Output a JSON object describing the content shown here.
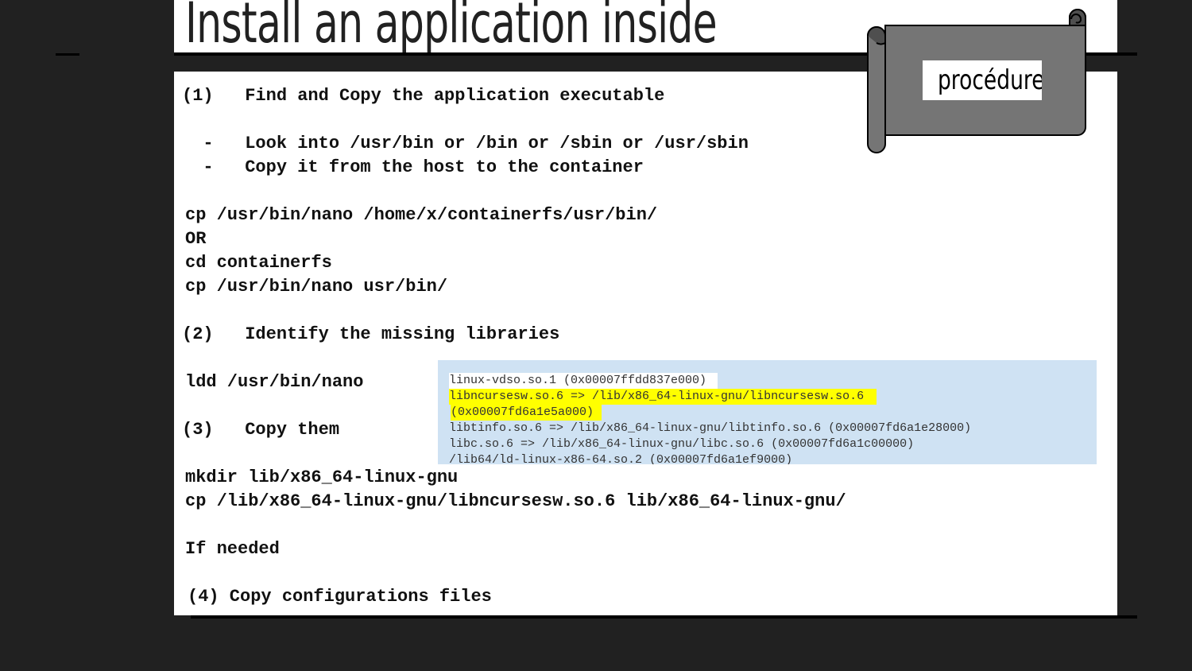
{
  "slide": {
    "title": "Install an application inside",
    "badge": "procédure"
  },
  "steps": {
    "s1_title": "(1)   Find and Copy the application executable",
    "s1_bullet1": "  -   Look into /usr/bin or /bin or /sbin or /usr/sbin",
    "s1_bullet2": "  -   Copy it from the host to the container",
    "s1_cmd1": "cp /usr/bin/nano /home/x/containerfs/usr/bin/",
    "s1_or": "OR",
    "s1_cmd2": "cd containerfs",
    "s1_cmd3": "cp /usr/bin/nano usr/bin/",
    "s2_title": "(2)   Identify the missing libraries",
    "s2_cmd": "ldd /usr/bin/nano",
    "s3_title": "(3)   Copy them",
    "s3_cmd1": "mkdir lib/x86_64-linux-gnu",
    "s3_cmd2": "cp /lib/x86_64-linux-gnu/libncursesw.so.6 lib/x86_64-linux-gnu/",
    "if_needed": "If needed",
    "s4_title": "(4) Copy configurations files"
  },
  "ldd_output": {
    "lines": [
      "linux-vdso.so.1 (0x00007ffdd837e000)",
      "libncursesw.so.6 => /lib/x86_64-linux-gnu/libncursesw.so.6",
      "(0x00007fd6a1e5a000)",
      "libtinfo.so.6 => /lib/x86_64-linux-gnu/libtinfo.so.6 (0x00007fd6a1e28000)",
      "libc.so.6 => /lib/x86_64-linux-gnu/libc.so.6 (0x00007fd6a1c00000)",
      "/lib64/ld-linux-x86-64.so.2 (0x00007fd6a1ef9000)"
    ]
  },
  "colors": {
    "background": "#212121",
    "ldd_box": "#cfe2f3",
    "highlight": "#ffff00",
    "scroll_fill": "#757575"
  }
}
